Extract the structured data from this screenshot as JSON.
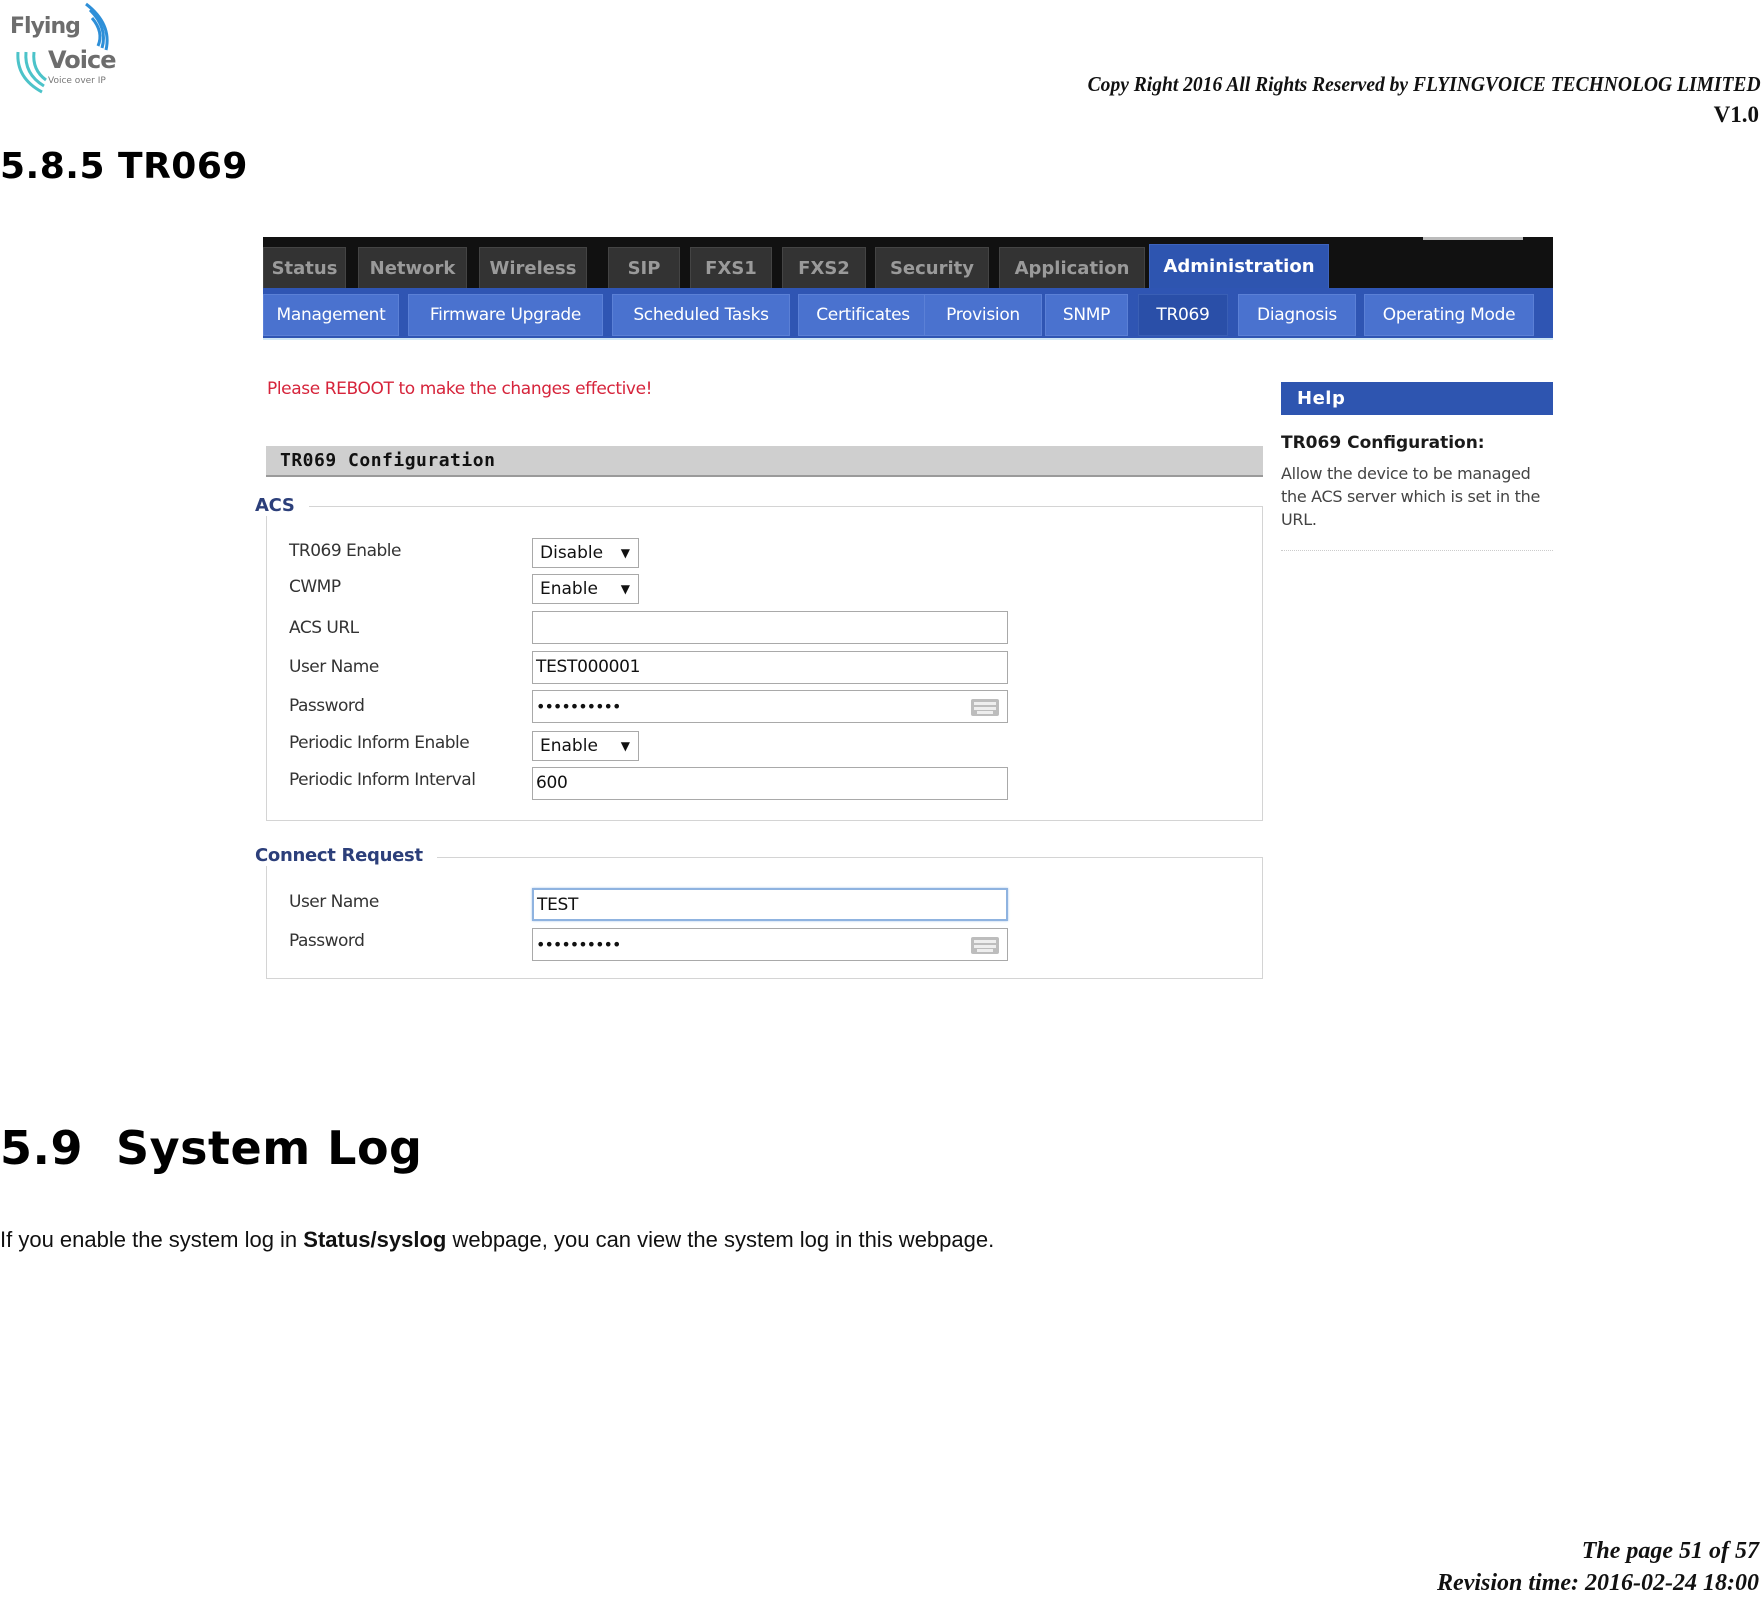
{
  "document": {
    "logo": {
      "line1": "Flying",
      "line2": "Voice",
      "tagline": "Voice over IP"
    },
    "copyright": "Copy Right 2016 All Rights Reserved by FLYINGVOICE TECHNOLOG LIMITED",
    "version": "V1.0",
    "section_tr069_heading": "5.8.5 TR069",
    "section_syslog_heading": "5.9  System Log",
    "syslog_paragraph": {
      "before": "If you enable the system log in ",
      "bold": "Status/syslog",
      "after": " webpage, you can view the system log in this webpage."
    },
    "footer": {
      "page": "The page 51 of 57",
      "revision": "Revision time: 2016-02-24 18:00"
    }
  },
  "ui": {
    "main_tabs": [
      {
        "label": "Status",
        "active": false
      },
      {
        "label": "Network",
        "active": false
      },
      {
        "label": "Wireless",
        "active": false
      },
      {
        "label": "SIP",
        "active": false
      },
      {
        "label": "FXS1",
        "active": false
      },
      {
        "label": "FXS2",
        "active": false
      },
      {
        "label": "Security",
        "active": false
      },
      {
        "label": "Application",
        "active": false
      },
      {
        "label": "Administration",
        "active": true
      }
    ],
    "sub_tabs": [
      {
        "label": "Management",
        "active": false
      },
      {
        "label": "Firmware Upgrade",
        "active": false
      },
      {
        "label": "Scheduled Tasks",
        "active": false
      },
      {
        "label": "Certificates",
        "active": false
      },
      {
        "label": "Provision",
        "active": false
      },
      {
        "label": "SNMP",
        "active": false
      },
      {
        "label": "TR069",
        "active": true
      },
      {
        "label": "Diagnosis",
        "active": false
      },
      {
        "label": "Operating Mode",
        "active": false
      }
    ],
    "reboot_notice": "Please REBOOT to make the changes effective!",
    "config_header": "TR069 Configuration",
    "acs": {
      "legend": "ACS",
      "tr069_enable": {
        "label": "TR069 Enable",
        "value": "Disable"
      },
      "cwmp": {
        "label": "CWMP",
        "value": "Enable"
      },
      "acs_url": {
        "label": "ACS URL",
        "value": ""
      },
      "user_name": {
        "label": "User Name",
        "value": "TEST000001"
      },
      "password": {
        "label": "Password",
        "value": "••••••••••"
      },
      "periodic_inform_enable": {
        "label": "Periodic Inform Enable",
        "value": "Enable"
      },
      "periodic_inform_interval": {
        "label": "Periodic Inform Interval",
        "value": "600"
      }
    },
    "connect_request": {
      "legend": "Connect Request",
      "user_name": {
        "label": "User Name",
        "value": "TEST"
      },
      "password": {
        "label": "Password",
        "value": "••••••••••"
      }
    },
    "help": {
      "header": "Help",
      "title": "TR069 Configuration:",
      "body": "Allow the device to be managed\nthe ACS server which is set in the\nURL."
    },
    "select_arrow": "▼",
    "colors": {
      "tab_bar": "#111111",
      "active_blue": "#2e55b0",
      "subtab_blue": "#4a72cf",
      "notice_red": "#d6243b",
      "legend_navy": "#2c3f7a"
    }
  }
}
